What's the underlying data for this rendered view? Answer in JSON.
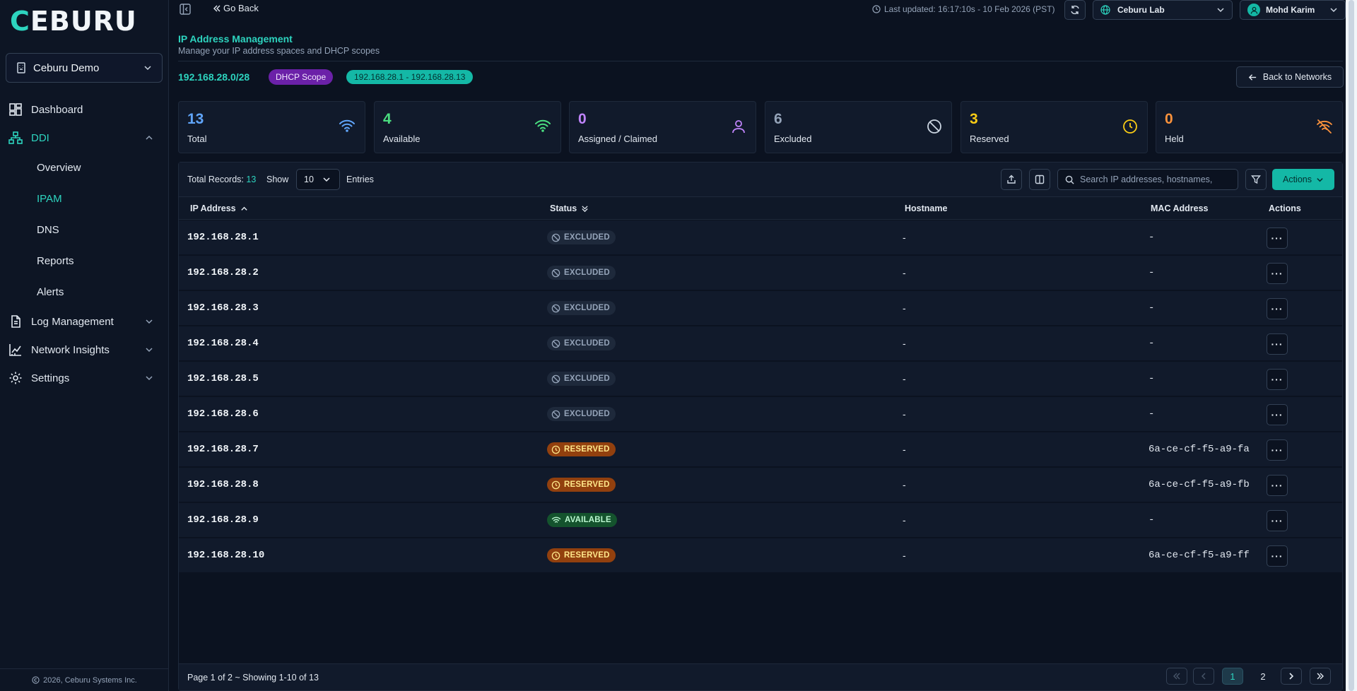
{
  "brand": {
    "logo_text": "CEBURU"
  },
  "sidebar": {
    "org_name": "Ceburu Demo",
    "items": [
      {
        "label": "Dashboard",
        "icon": "dashboard-icon"
      },
      {
        "label": "DDI",
        "icon": "network-icon",
        "expanded": true
      },
      {
        "label": "Log Management",
        "icon": "document-icon"
      },
      {
        "label": "Network Insights",
        "icon": "chart-icon"
      },
      {
        "label": "Settings",
        "icon": "gear-icon"
      }
    ],
    "ddi_sub": [
      {
        "label": "Overview"
      },
      {
        "label": "IPAM",
        "active": true
      },
      {
        "label": "DNS"
      },
      {
        "label": "Reports"
      },
      {
        "label": "Alerts"
      }
    ],
    "footer": "2026, Ceburu Systems Inc."
  },
  "topbar": {
    "go_back": "Go Back",
    "last_updated": "Last updated: 16:17:10s - 10 Feb 2026 (PST)",
    "lab": "Ceburu Lab",
    "user": "Mohd Karim"
  },
  "header": {
    "title": "IP Address Management",
    "subtitle": "Manage your IP address spaces and DHCP scopes",
    "subnet": "192.168.28.0/28",
    "scope_badge": "DHCP Scope",
    "range_badge": "192.168.28.1 - 192.168.28.13",
    "back_button": "Back to Networks"
  },
  "stats": [
    {
      "value": "13",
      "label": "Total",
      "color": "#60a5fa",
      "icon": "wifi-icon"
    },
    {
      "value": "4",
      "label": "Available",
      "color": "#4ade80",
      "icon": "wifi-icon"
    },
    {
      "value": "0",
      "label": "Assigned / Claimed",
      "color": "#c084fc",
      "icon": "user-icon"
    },
    {
      "value": "6",
      "label": "Excluded",
      "color": "#94a3b8",
      "icon": "ban-icon"
    },
    {
      "value": "3",
      "label": "Reserved",
      "color": "#facc15",
      "icon": "clock-icon"
    },
    {
      "value": "0",
      "label": "Held",
      "color": "#fb923c",
      "icon": "wifi-off-icon"
    }
  ],
  "table": {
    "total_label": "Total Records:",
    "total_count": "13",
    "show_label": "Show",
    "page_size": "10",
    "entries_label": "Entries",
    "search_placeholder": "Search IP addresses, hostnames,",
    "actions_label": "Actions",
    "columns": [
      "IP Address",
      "Status",
      "Hostname",
      "MAC Address",
      "Actions"
    ],
    "rows": [
      {
        "ip": "192.168.28.1",
        "status": "EXCLUDED",
        "hostname": "-",
        "mac": "-"
      },
      {
        "ip": "192.168.28.2",
        "status": "EXCLUDED",
        "hostname": "-",
        "mac": "-"
      },
      {
        "ip": "192.168.28.3",
        "status": "EXCLUDED",
        "hostname": "-",
        "mac": "-"
      },
      {
        "ip": "192.168.28.4",
        "status": "EXCLUDED",
        "hostname": "-",
        "mac": "-"
      },
      {
        "ip": "192.168.28.5",
        "status": "EXCLUDED",
        "hostname": "-",
        "mac": "-"
      },
      {
        "ip": "192.168.28.6",
        "status": "EXCLUDED",
        "hostname": "-",
        "mac": "-"
      },
      {
        "ip": "192.168.28.7",
        "status": "RESERVED",
        "hostname": "-",
        "mac": "6a-ce-cf-f5-a9-fa"
      },
      {
        "ip": "192.168.28.8",
        "status": "RESERVED",
        "hostname": "-",
        "mac": "6a-ce-cf-f5-a9-fb"
      },
      {
        "ip": "192.168.28.9",
        "status": "AVAILABLE",
        "hostname": "-",
        "mac": "-"
      },
      {
        "ip": "192.168.28.10",
        "status": "RESERVED",
        "hostname": "-",
        "mac": "6a-ce-cf-f5-a9-ff"
      }
    ],
    "row_action_label": "···",
    "pagination": {
      "info": "Page 1 of 2 ~ Showing 1-10 of 13",
      "pages": [
        "1",
        "2"
      ],
      "current": "1"
    }
  }
}
